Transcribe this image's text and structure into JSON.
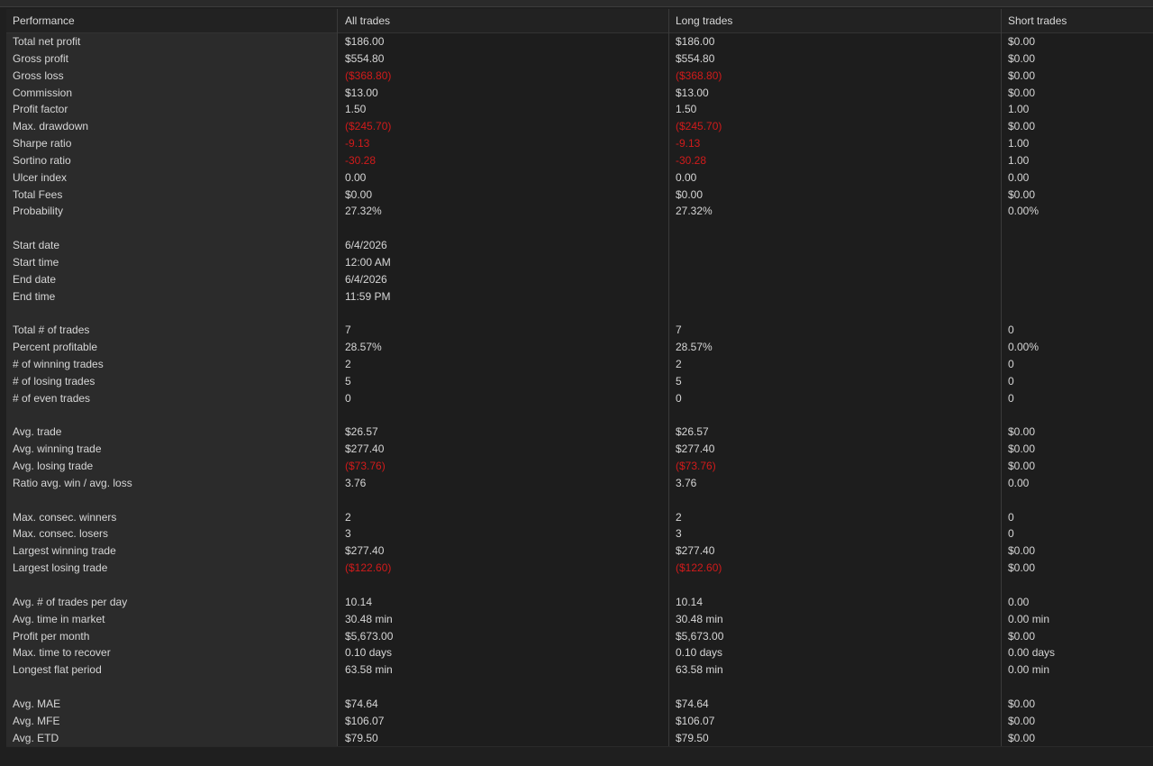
{
  "headers": {
    "label": "Performance",
    "all": "All trades",
    "long": "Long trades",
    "short": "Short trades"
  },
  "rows": [
    {
      "label": "Total net profit",
      "all": "$186.00",
      "long": "$186.00",
      "short": "$0.00"
    },
    {
      "label": "Gross profit",
      "all": "$554.80",
      "long": "$554.80",
      "short": "$0.00"
    },
    {
      "label": "Gross loss",
      "all": "($368.80)",
      "long": "($368.80)",
      "short": "$0.00",
      "neg": true
    },
    {
      "label": "Commission",
      "all": "$13.00",
      "long": "$13.00",
      "short": "$0.00"
    },
    {
      "label": "Profit factor",
      "all": "1.50",
      "long": "1.50",
      "short": "1.00"
    },
    {
      "label": "Max. drawdown",
      "all": "($245.70)",
      "long": "($245.70)",
      "short": "$0.00",
      "neg": true
    },
    {
      "label": "Sharpe ratio",
      "all": "-9.13",
      "long": "-9.13",
      "short": "1.00",
      "neg": true
    },
    {
      "label": "Sortino ratio",
      "all": "-30.28",
      "long": "-30.28",
      "short": "1.00",
      "neg": true
    },
    {
      "label": "Ulcer index",
      "all": "0.00",
      "long": "0.00",
      "short": "0.00"
    },
    {
      "label": "Total Fees",
      "all": "$0.00",
      "long": "$0.00",
      "short": "$0.00"
    },
    {
      "label": "Probability",
      "all": "27.32%",
      "long": "27.32%",
      "short": "0.00%"
    },
    {
      "label": "",
      "all": "",
      "long": "",
      "short": ""
    },
    {
      "label": "Start date",
      "all": "6/4/2026",
      "long": "",
      "short": ""
    },
    {
      "label": "Start time",
      "all": "12:00 AM",
      "long": "",
      "short": ""
    },
    {
      "label": "End date",
      "all": "6/4/2026",
      "long": "",
      "short": ""
    },
    {
      "label": "End time",
      "all": "11:59 PM",
      "long": "",
      "short": ""
    },
    {
      "label": "",
      "all": "",
      "long": "",
      "short": ""
    },
    {
      "label": "Total # of trades",
      "all": "7",
      "long": "7",
      "short": "0"
    },
    {
      "label": "Percent profitable",
      "all": "28.57%",
      "long": "28.57%",
      "short": "0.00%"
    },
    {
      "label": "# of winning trades",
      "all": "2",
      "long": "2",
      "short": "0"
    },
    {
      "label": "# of losing trades",
      "all": "5",
      "long": "5",
      "short": "0"
    },
    {
      "label": "# of even trades",
      "all": "0",
      "long": "0",
      "short": "0"
    },
    {
      "label": "",
      "all": "",
      "long": "",
      "short": ""
    },
    {
      "label": "Avg. trade",
      "all": "$26.57",
      "long": "$26.57",
      "short": "$0.00"
    },
    {
      "label": "Avg. winning trade",
      "all": "$277.40",
      "long": "$277.40",
      "short": "$0.00"
    },
    {
      "label": "Avg. losing trade",
      "all": "($73.76)",
      "long": "($73.76)",
      "short": "$0.00",
      "neg": true
    },
    {
      "label": "Ratio avg. win / avg. loss",
      "all": "3.76",
      "long": "3.76",
      "short": "0.00"
    },
    {
      "label": "",
      "all": "",
      "long": "",
      "short": ""
    },
    {
      "label": "Max. consec. winners",
      "all": "2",
      "long": "2",
      "short": "0"
    },
    {
      "label": "Max. consec. losers",
      "all": "3",
      "long": "3",
      "short": "0"
    },
    {
      "label": "Largest winning trade",
      "all": "$277.40",
      "long": "$277.40",
      "short": "$0.00"
    },
    {
      "label": "Largest losing trade",
      "all": "($122.60)",
      "long": "($122.60)",
      "short": "$0.00",
      "neg": true
    },
    {
      "label": "",
      "all": "",
      "long": "",
      "short": ""
    },
    {
      "label": "Avg. # of trades per day",
      "all": "10.14",
      "long": "10.14",
      "short": "0.00"
    },
    {
      "label": "Avg. time in market",
      "all": "30.48 min",
      "long": "30.48 min",
      "short": "0.00 min"
    },
    {
      "label": "Profit per month",
      "all": "$5,673.00",
      "long": "$5,673.00",
      "short": "$0.00"
    },
    {
      "label": "Max. time to recover",
      "all": "0.10 days",
      "long": "0.10 days",
      "short": "0.00 days"
    },
    {
      "label": "Longest flat period",
      "all": "63.58 min",
      "long": "63.58 min",
      "short": "0.00 min"
    },
    {
      "label": "",
      "all": "",
      "long": "",
      "short": ""
    },
    {
      "label": "Avg. MAE",
      "all": "$74.64",
      "long": "$74.64",
      "short": "$0.00"
    },
    {
      "label": "Avg. MFE",
      "all": "$106.07",
      "long": "$106.07",
      "short": "$0.00"
    },
    {
      "label": "Avg. ETD",
      "all": "$79.50",
      "long": "$79.50",
      "short": "$0.00"
    }
  ],
  "colors": {
    "background": "#1f1f1f",
    "label_column": "#2b2b2b",
    "text": "#d6d6d6",
    "negative": "#d11b1b"
  }
}
